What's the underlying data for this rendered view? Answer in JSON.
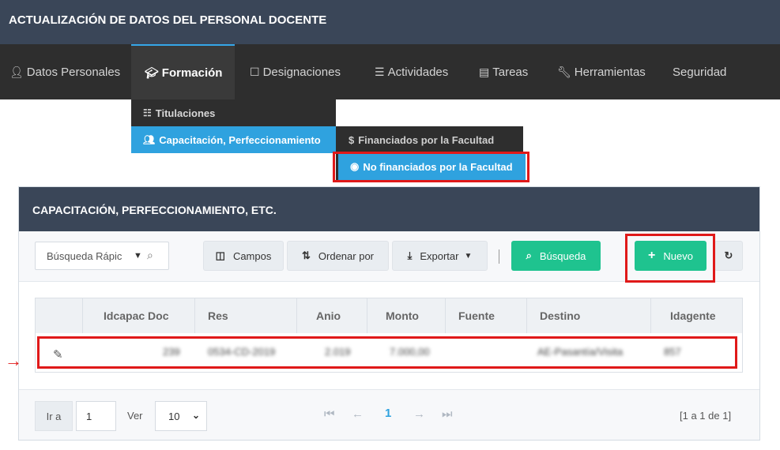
{
  "header": {
    "title": "ACTUALIZACIÓN DE DATOS DEL PERSONAL DOCENTE"
  },
  "nav": {
    "items": [
      {
        "label": "Datos Personales",
        "icon": "user-icon"
      },
      {
        "label": "Formación",
        "icon": "graduation-cap-icon"
      },
      {
        "label": "Designaciones",
        "icon": "id-card-icon"
      },
      {
        "label": "Actividades",
        "icon": "checklist-icon"
      },
      {
        "label": "Tareas",
        "icon": "clipboard-icon"
      },
      {
        "label": "Herramientas",
        "icon": "wrench-icon"
      },
      {
        "label": "Seguridad",
        "icon": ""
      }
    ]
  },
  "dropdown": {
    "items": [
      {
        "label": "Titulaciones",
        "icon": "diploma-icon"
      },
      {
        "label": "Capacitación, Perfeccionamiento",
        "icon": "teacher-icon"
      }
    ]
  },
  "submenu": {
    "items": [
      {
        "label": "Financiados por la Facultad",
        "icon": "dollar-icon"
      },
      {
        "label": "No financiados por la Facultad",
        "icon": "no-money-icon"
      }
    ]
  },
  "panel": {
    "title": "CAPACITACIÓN, PERFECCIONAMIENTO, ETC."
  },
  "toolbar": {
    "search_placeholder": "Búsqueda Rápic",
    "campos_label": "Campos",
    "ordenar_label": "Ordenar por",
    "exportar_label": "Exportar",
    "busqueda_label": "Búsqueda",
    "nuevo_label": "Nuevo"
  },
  "table": {
    "columns": [
      "Idcapac Doc",
      "Res",
      "Anio",
      "Monto",
      "Fuente",
      "Destino",
      "Idagente"
    ],
    "rows": [
      {
        "idcapac": "239",
        "res": "0534-CD-2019",
        "anio": "2.019",
        "monto": "7.000,00",
        "fuente": "",
        "destino": "AE-Pasantía/Visita",
        "idagente": "857"
      }
    ]
  },
  "footer": {
    "ira_label": "Ir a",
    "page_value": "1",
    "ver_label": "Ver",
    "ver_value": "10",
    "current_page": "1",
    "count": "[1 a 1 de 1]"
  },
  "colors": {
    "header": "#3a4658",
    "nav": "#2e2e2e",
    "active": "#2fa2df",
    "green": "#1fc38f",
    "highlight": "#e01919"
  }
}
